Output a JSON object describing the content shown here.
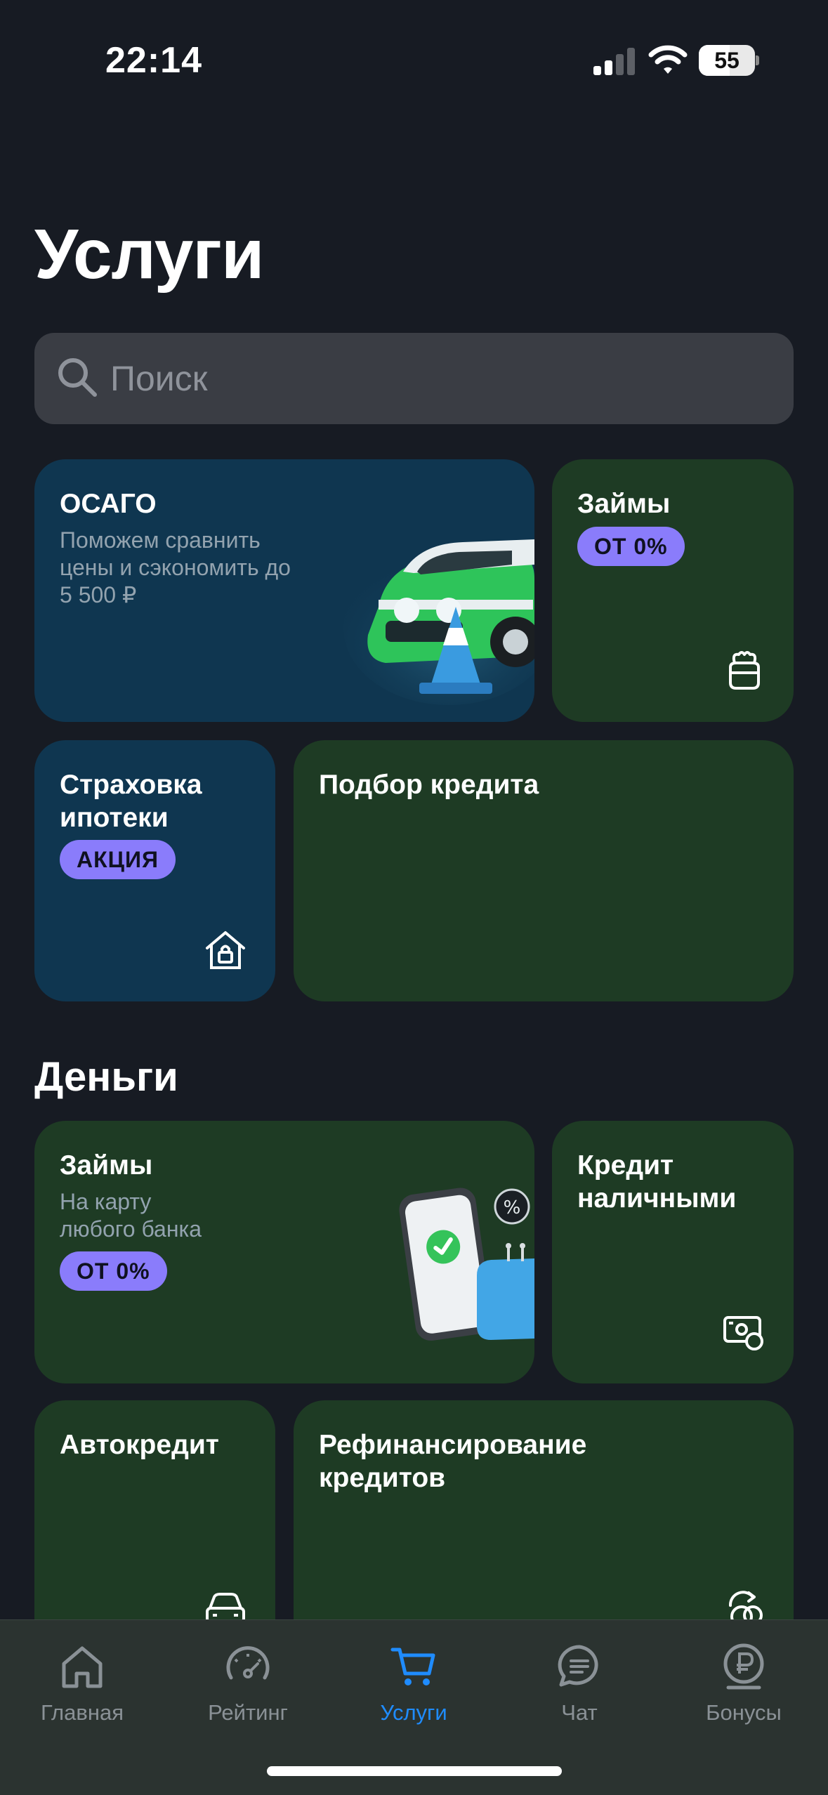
{
  "status_bar": {
    "time": "22:14",
    "battery_level": "55",
    "battery_fraction": 0.55
  },
  "page": {
    "title": "Услуги"
  },
  "search": {
    "placeholder": "Поиск",
    "value": ""
  },
  "services": {
    "osago": {
      "title": "ОСАГО",
      "subtitle_lines": [
        "Поможем сравнить",
        "цены и сэкономить до",
        "5 500 ₽"
      ]
    },
    "loans_top": {
      "title": "Займы",
      "badge": "ОТ 0%",
      "icon": "wallet-icon"
    },
    "mortgage_insurance": {
      "title_lines": [
        "Страховка",
        "ипотеки"
      ],
      "badge": "АКЦИЯ",
      "icon": "house-lock-icon"
    },
    "credit_selection": {
      "title": "Подбор кредита"
    }
  },
  "money": {
    "section_title": "Деньги",
    "loans": {
      "title": "Займы",
      "subtitle_lines": [
        "На карту",
        "любого банка"
      ],
      "badge": "ОТ 0%"
    },
    "cash_credit": {
      "title_lines": [
        "Кредит",
        "наличными"
      ],
      "icon": "cash-icon"
    },
    "auto_credit": {
      "title": "Автокредит",
      "icon": "car-icon"
    },
    "refinancing": {
      "title_lines": [
        "Рефинансирование",
        "кредитов"
      ],
      "icon": "refresh-coins-icon"
    }
  },
  "tab_bar": {
    "tabs": [
      {
        "label": "Главная",
        "icon": "home-icon",
        "active": false
      },
      {
        "label": "Рейтинг",
        "icon": "speedometer-icon",
        "active": false
      },
      {
        "label": "Услуги",
        "icon": "cart-icon",
        "active": true
      },
      {
        "label": "Чат",
        "icon": "chat-icon",
        "active": false
      },
      {
        "label": "Бонусы",
        "icon": "ruble-coin-icon",
        "active": false
      }
    ]
  },
  "colors": {
    "background": "#171b23",
    "card_blue": "#0f3650",
    "card_green": "#1e3b24",
    "badge": "#8a7cfb",
    "accent": "#1f8cff"
  }
}
